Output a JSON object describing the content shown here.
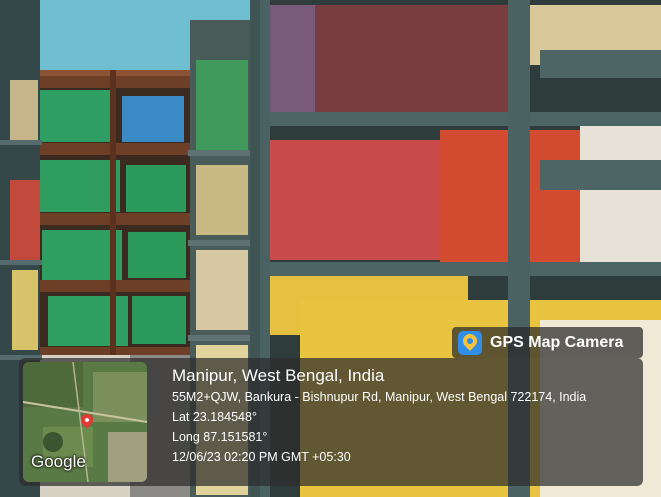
{
  "overlay": {
    "app_badge": "GPS Map Camera",
    "map_logo": "Google",
    "place": "Manipur, West Bengal, India",
    "address": "55M2+QJW, Bankura - Bishnupur Rd, Manipur, West Bengal 722174, India",
    "lat": "Lat 23.184548°",
    "long": "Long 87.151581°",
    "datetime": "12/06/23 02:20 PM GMT +05:30"
  },
  "colors": {
    "shelf_frame": "#3f5a5c",
    "wall": "#6fbfd0",
    "overlay_bg": "#2d2d2d",
    "badge_accent": "#2f8ee5",
    "pin": "#e53935"
  }
}
